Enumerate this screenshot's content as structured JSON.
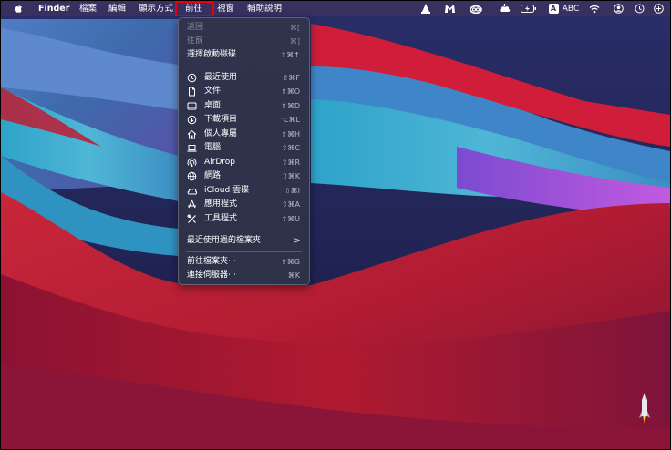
{
  "menubar": {
    "apple": "",
    "app_name": "Finder",
    "menus": [
      "檔案",
      "編輯",
      "顯示方式",
      "前往",
      "視窗",
      "輔助說明"
    ],
    "input_source": "ABC",
    "input_badge": "A"
  },
  "go_menu": {
    "items": [
      {
        "label": "返回",
        "shortcut": "⌘[",
        "disabled": true
      },
      {
        "label": "往前",
        "shortcut": "⌘]",
        "disabled": true
      },
      {
        "label": "選擇啟動磁碟",
        "shortcut": "⇧⌘↑",
        "disabled": false
      },
      {
        "label": "最近使用",
        "shortcut": "⇧⌘F",
        "icon": "clock-icon"
      },
      {
        "label": "文件",
        "shortcut": "⇧⌘O",
        "icon": "document-icon"
      },
      {
        "label": "桌面",
        "shortcut": "⇧⌘D",
        "icon": "desktop-icon"
      },
      {
        "label": "下載項目",
        "shortcut": "⌥⌘L",
        "icon": "download-icon"
      },
      {
        "label": "個人專屬",
        "shortcut": "⇧⌘H",
        "icon": "home-icon"
      },
      {
        "label": "電腦",
        "shortcut": "⇧⌘C",
        "icon": "laptop-icon"
      },
      {
        "label": "AirDrop",
        "shortcut": "⇧⌘R",
        "icon": "airdrop-icon"
      },
      {
        "label": "網路",
        "shortcut": "⇧⌘K",
        "icon": "globe-icon"
      },
      {
        "label": "iCloud 雲碟",
        "shortcut": "⇧⌘I",
        "icon": "cloud-icon"
      },
      {
        "label": "應用程式",
        "shortcut": "⇧⌘A",
        "icon": "applications-icon"
      },
      {
        "label": "工具程式",
        "shortcut": "⇧⌘U",
        "icon": "tools-icon"
      },
      {
        "label": "最近使用過的檔案夾",
        "shortcut": ">"
      },
      {
        "label": "前往檔案夾⋯",
        "shortcut": "⇧⌘G"
      },
      {
        "label": "連接伺服器⋯",
        "shortcut": "⌘K"
      }
    ]
  }
}
